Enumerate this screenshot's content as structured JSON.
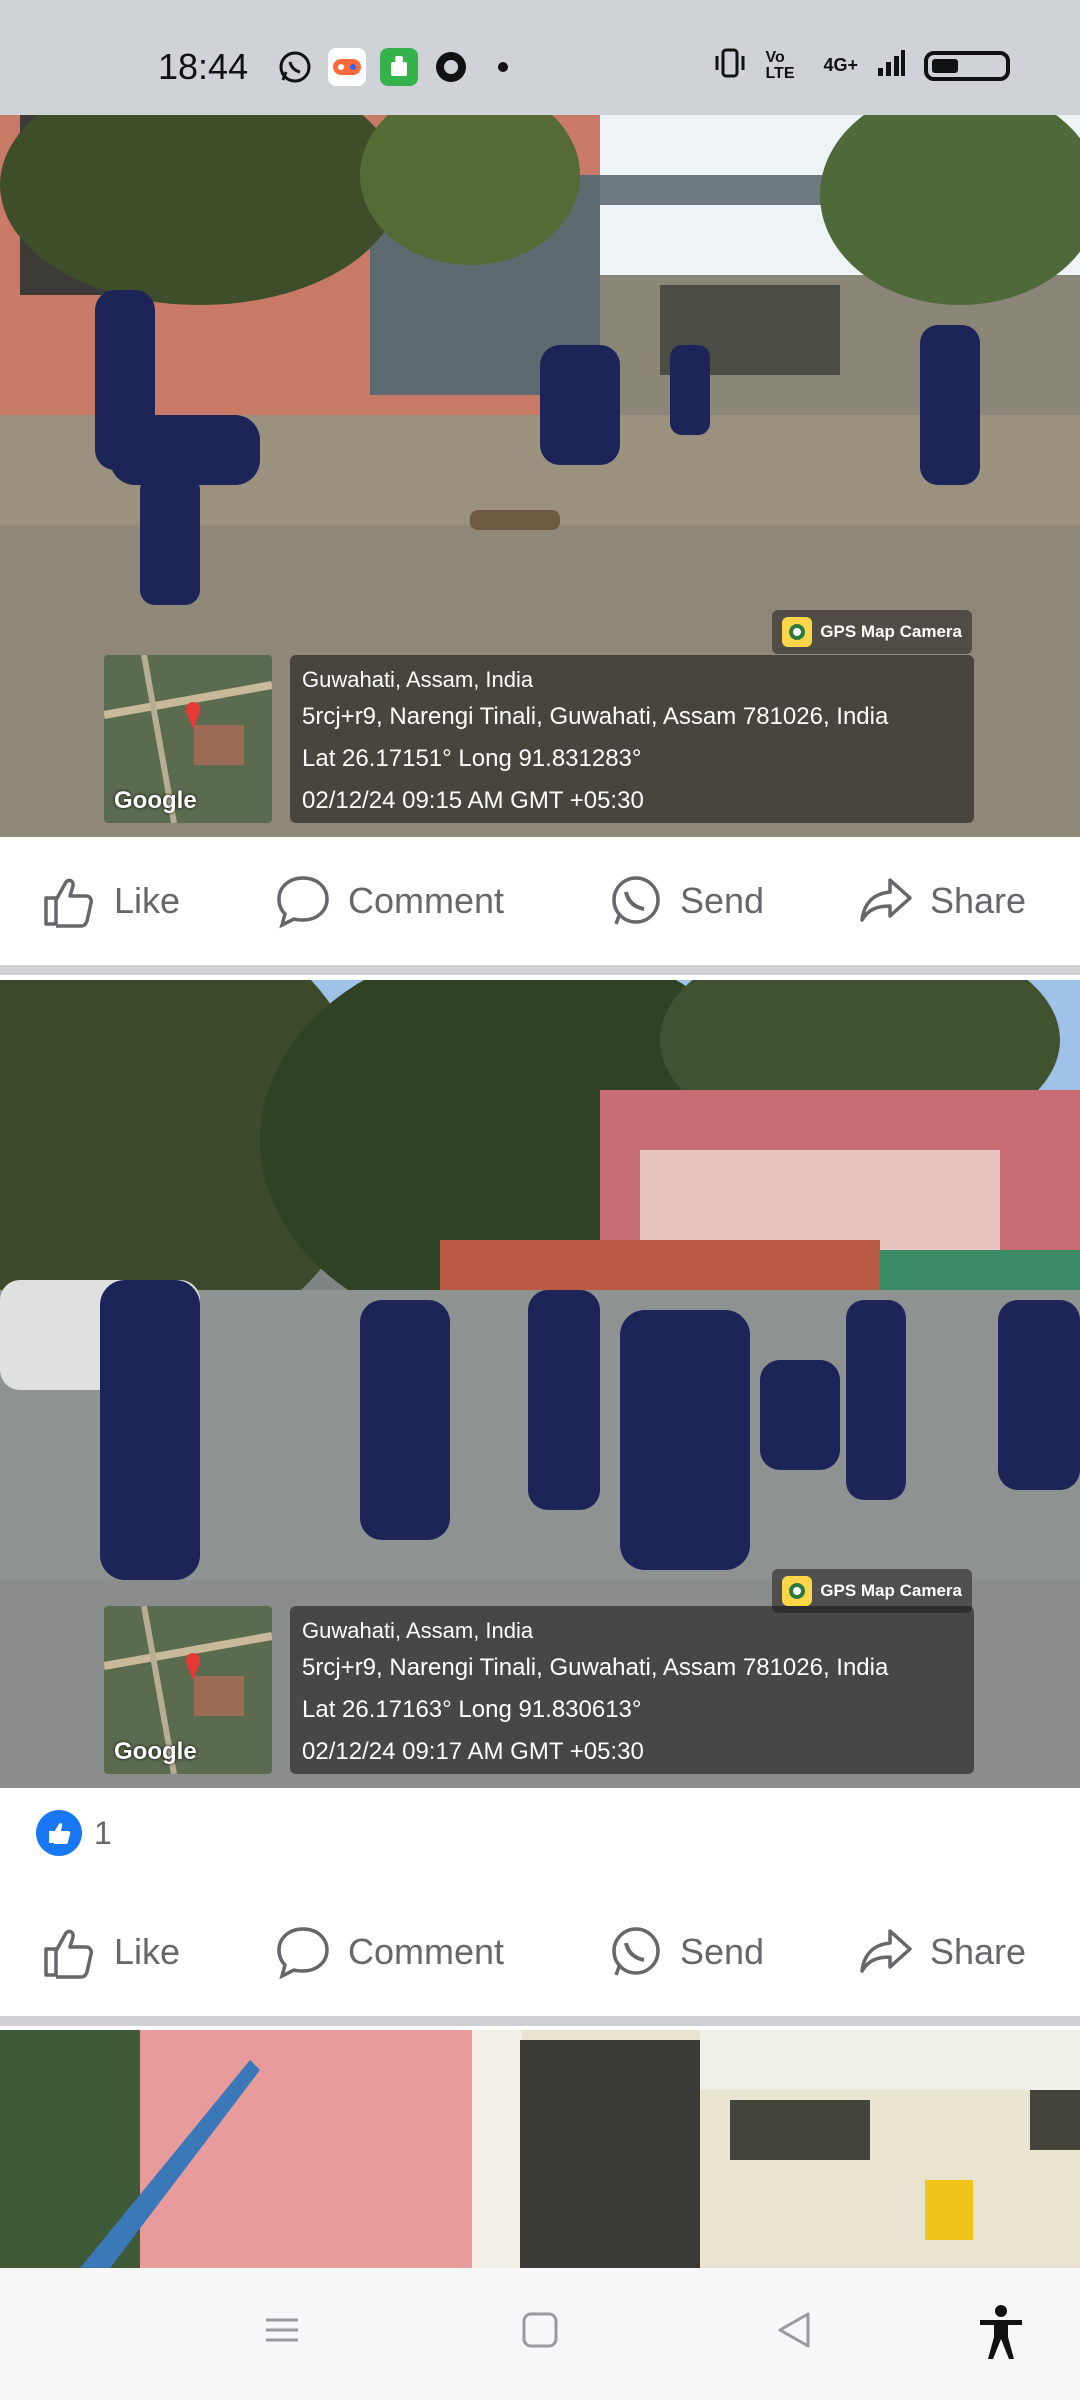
{
  "status_bar": {
    "time": "18:44",
    "right_labels": [
      "Vo LTE",
      "4G+"
    ],
    "app_icons": [
      "whatsapp-icon",
      "game-icon",
      "android-app-icon",
      "vpn-icon",
      "dot-icon"
    ]
  },
  "posts": [
    {
      "gps_badge": "GPS Map Camera",
      "map_label": "Google",
      "location": "Guwahati, Assam, India",
      "address": "5rcj+r9, Narengi Tinali, Guwahati, Assam 781026, India",
      "coords": "Lat 26.17151° Long 91.831283°",
      "datetime": "02/12/24 09:15 AM GMT +05:30"
    },
    {
      "gps_badge": "GPS Map Camera",
      "map_label": "Google",
      "location": "Guwahati, Assam, India",
      "address": "5rcj+r9, Narengi Tinali, Guwahati, Assam 781026, India",
      "coords": "Lat 26.17163° Long 91.830613°",
      "datetime": "02/12/24 09:17 AM GMT +05:30",
      "reaction_count": "1"
    }
  ],
  "actions": {
    "like": "Like",
    "comment": "Comment",
    "send": "Send",
    "share": "Share"
  },
  "colors": {
    "status_bg": "#cfd2d6",
    "action_text": "#65676b",
    "like_blue": "#1877f2",
    "divider": "#ced0d4"
  }
}
